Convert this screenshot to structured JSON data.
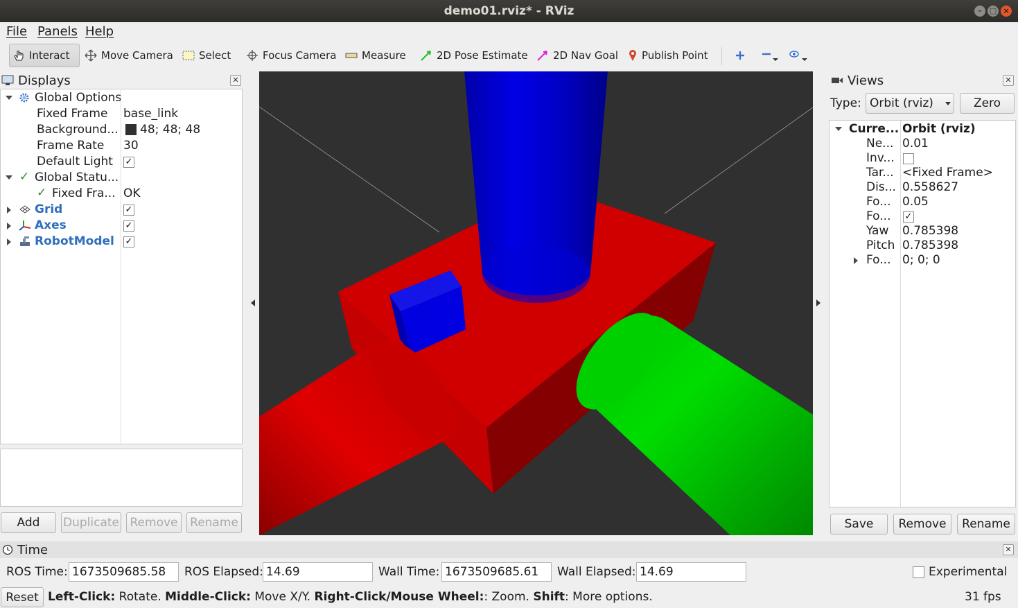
{
  "window": {
    "title": "demo01.rviz* - RViz"
  },
  "menu": [
    "File",
    "Panels",
    "Help"
  ],
  "toolbar": {
    "tools": [
      {
        "label": "Interact",
        "icon": "hand-icon",
        "active": true
      },
      {
        "label": "Move Camera",
        "icon": "move-camera-icon"
      },
      {
        "label": "Select",
        "icon": "select-box-icon"
      },
      {
        "label": "Focus Camera",
        "icon": "focus-camera-icon"
      },
      {
        "label": "Measure",
        "icon": "ruler-icon"
      },
      {
        "label": "2D Pose Estimate",
        "icon": "green-arrow-icon"
      },
      {
        "label": "2D Nav Goal",
        "icon": "magenta-arrow-icon"
      },
      {
        "label": "Publish Point",
        "icon": "map-pin-icon"
      }
    ],
    "extra_icons": [
      "add-tool-icon",
      "remove-tool-icon",
      "eye-icon"
    ]
  },
  "displays": {
    "title": "Displays",
    "global_options": {
      "label": "Global Options",
      "fixed_frame_label": "Fixed Frame",
      "fixed_frame": "base_link",
      "background_label": "Background...",
      "background": "48; 48; 48",
      "background_color": "#303030",
      "frame_rate_label": "Frame Rate",
      "frame_rate": "30",
      "default_light_label": "Default Light",
      "default_light": true
    },
    "global_status": {
      "label": "Global Statu...",
      "child_label": "Fixed Fra...",
      "child_value": "OK"
    },
    "items": [
      {
        "label": "Grid",
        "icon": "grid-icon",
        "enabled": true
      },
      {
        "label": "Axes",
        "icon": "axes-icon",
        "enabled": true
      },
      {
        "label": "RobotModel",
        "icon": "robot-model-icon",
        "enabled": true
      }
    ],
    "buttons": {
      "add": "Add",
      "duplicate": "Duplicate",
      "remove": "Remove",
      "rename": "Rename"
    }
  },
  "views": {
    "title": "Views",
    "type_label": "Type:",
    "type_value": "Orbit (rviz)",
    "zero": "Zero",
    "current_label": "Curre...",
    "current_value": "Orbit (rviz)",
    "props": [
      {
        "k": "Ne...",
        "v": "0.01"
      },
      {
        "k": "Inv...",
        "v": "",
        "check": false
      },
      {
        "k": "Tar...",
        "v": "<Fixed Frame>"
      },
      {
        "k": "Dis...",
        "v": "0.558627"
      },
      {
        "k": "Fo...",
        "v": "0.05"
      },
      {
        "k": "Fo...",
        "v": "",
        "check": true
      },
      {
        "k": "Yaw",
        "v": "0.785398"
      },
      {
        "k": "Pitch",
        "v": "0.785398"
      },
      {
        "k": "Fo...",
        "v": "0; 0; 0",
        "expandable": true
      }
    ],
    "buttons": {
      "save": "Save",
      "remove": "Remove",
      "rename": "Rename"
    }
  },
  "time": {
    "title": "Time",
    "ros_time_label": "ROS Time:",
    "ros_time": "1673509685.58",
    "ros_elapsed_label": "ROS Elapsed:",
    "ros_elapsed": "14.69",
    "wall_time_label": "Wall Time:",
    "wall_time": "1673509685.61",
    "wall_elapsed_label": "Wall Elapsed:",
    "wall_elapsed": "14.69",
    "experimental": "Experimental"
  },
  "status": {
    "reset": "Reset",
    "hint": [
      {
        "b": "Left-Click:",
        "t": " Rotate. "
      },
      {
        "b": "Middle-Click:",
        "t": " Move X/Y. "
      },
      {
        "b": "Right-Click/Mouse Wheel:",
        "t": ": Zoom. "
      },
      {
        "b": "Shift",
        "t": ": More options."
      }
    ],
    "fps": "31 fps"
  }
}
